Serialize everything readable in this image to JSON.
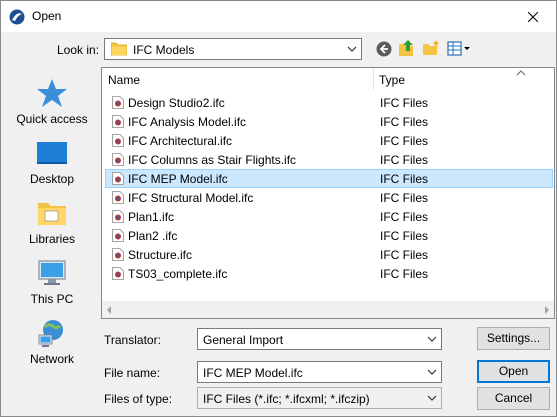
{
  "window": {
    "title": "Open"
  },
  "lookin": {
    "label": "Look in:",
    "value": "IFC Models"
  },
  "places": [
    {
      "label": "Quick access",
      "icon": "quick-access-icon"
    },
    {
      "label": "Desktop",
      "icon": "desktop-icon"
    },
    {
      "label": "Libraries",
      "icon": "libraries-icon"
    },
    {
      "label": "This PC",
      "icon": "this-pc-icon"
    },
    {
      "label": "Network",
      "icon": "network-icon"
    }
  ],
  "filelist": {
    "columns": {
      "name": "Name",
      "type": "Type"
    },
    "files": [
      {
        "name": "Design Studio2.ifc",
        "type": "IFC Files"
      },
      {
        "name": "IFC Analysis Model.ifc",
        "type": "IFC Files"
      },
      {
        "name": "IFC Architectural.ifc",
        "type": "IFC Files"
      },
      {
        "name": "IFC Columns as Stair Flights.ifc",
        "type": "IFC Files"
      },
      {
        "name": "IFC MEP Model.ifc",
        "type": "IFC Files",
        "selected": true
      },
      {
        "name": "IFC Structural Model.ifc",
        "type": "IFC Files"
      },
      {
        "name": "Plan1.ifc",
        "type": "IFC Files"
      },
      {
        "name": "Plan2 .ifc",
        "type": "IFC Files"
      },
      {
        "name": "Structure.ifc",
        "type": "IFC Files"
      },
      {
        "name": "TS03_complete.ifc",
        "type": "IFC Files"
      }
    ]
  },
  "translator": {
    "label": "Translator:",
    "value": "General Import"
  },
  "filename": {
    "label": "File name:",
    "value": "IFC MEP Model.ifc"
  },
  "filetype": {
    "label": "Files of type:",
    "value": "IFC Files (*.ifc; *.ifcxml; *.ifczip)"
  },
  "buttons": {
    "settings": "Settings...",
    "open": "Open",
    "cancel": "Cancel"
  },
  "colors": {
    "selection": "#cce8ff",
    "selection_border": "#99d1ff",
    "accent": "#0078d7"
  }
}
